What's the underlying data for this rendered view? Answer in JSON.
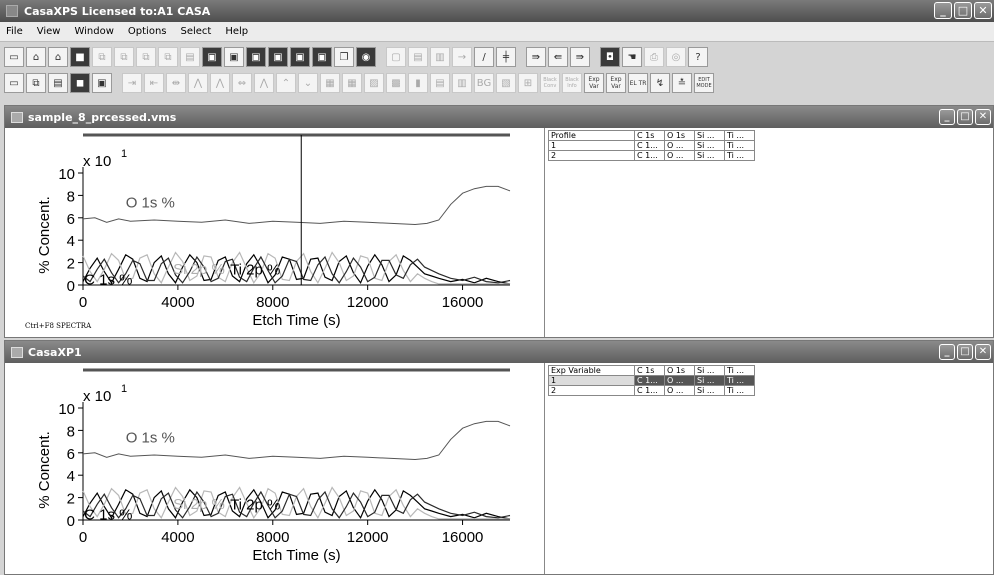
{
  "app": {
    "title": "CasaXPS Licensed to:A1 CASA",
    "window_buttons": [
      "_",
      "□",
      "✕"
    ]
  },
  "menu": [
    "File",
    "View",
    "Window",
    "Options",
    "Select",
    "Help"
  ],
  "toolbar1": [
    "new-icon",
    "open-icon",
    "open-multi-icon",
    "save-icon",
    "copy-icon",
    "copy2-icon",
    "copy3-icon",
    "copy4-icon",
    "paste-icon",
    "disk1-icon",
    "disk2-icon",
    "disk3-icon",
    "disk4-icon",
    "disk5-icon",
    "disk6-icon",
    "pages-icon",
    "camera-icon",
    "frame-icon",
    "frame2-icon",
    "frame3-icon",
    "arrow-icon",
    "line-icon",
    "chart-icon",
    "print-icon",
    "print2-icon",
    "print3-icon",
    "bucket-icon",
    "hand-icon",
    "printer-icon",
    "preview-icon",
    "help-icon"
  ],
  "toolbar2": [
    "tile-icon",
    "tile2-icon",
    "tile3-icon",
    "tile4-icon",
    "tile5-icon",
    "step-icon",
    "shrink-icon",
    "expand-icon",
    "peak1-icon",
    "peak2-icon",
    "peak3-icon",
    "peak4-icon",
    "peak5-icon",
    "peak6-icon",
    "grid1-icon",
    "grid2-icon",
    "grid3-icon",
    "grid4-icon",
    "bar1-icon",
    "bar2-icon",
    "bar3-icon",
    "bg-icon",
    "sub-icon",
    "fit-icon",
    "black-icon",
    "black2-icon",
    "expvar-icon",
    "expvar2-icon",
    "el-icon",
    "shift-icon",
    "stack-icon",
    "edit-icon"
  ],
  "toolbar2_labels": {
    "bg": "BG",
    "black": "Black Conv",
    "black2": "Black Info",
    "expvar": "Exp Var",
    "expvar2": "Exp Var",
    "el": "EL TR",
    "edit": "EDIT MODE"
  },
  "window1": {
    "title": "sample_8_prcessed.vms",
    "table": {
      "columns": [
        "Profile",
        "C 1s",
        "O 1s",
        "Si ...",
        "Ti ..."
      ],
      "rows": [
        [
          "1",
          "C 1...",
          "O ...",
          "Si ...",
          "Ti ..."
        ],
        [
          "2",
          "C 1...",
          "O ...",
          "Si ...",
          "Ti ..."
        ]
      ]
    },
    "footer_label": "Ctrl+F8 SPECTRA",
    "cursor_x": 9200
  },
  "window2": {
    "title": "CasaXP1",
    "table": {
      "columns": [
        "Exp Variable",
        "C 1s",
        "O 1s",
        "Si ...",
        "Ti ..."
      ],
      "rows": [
        [
          "1",
          "C 1...",
          "O ...",
          "Si ...",
          "Ti ..."
        ],
        [
          "2",
          "C 1...",
          "O ...",
          "Si ...",
          "Ti ..."
        ]
      ],
      "selected_row": 0
    }
  },
  "chart_data": [
    {
      "type": "line",
      "xlabel": "Etch Time (s)",
      "ylabel": "% Concent.",
      "y_multiplier": "x 10",
      "y_multiplier_exp": "1",
      "xlim": [
        0,
        18000
      ],
      "ylim": [
        0,
        10
      ],
      "xticks": [
        0,
        4000,
        8000,
        12000,
        16000
      ],
      "yticks": [
        0,
        2,
        4,
        6,
        8,
        10
      ],
      "series_labels": [
        "O 1s %",
        "C 1s %",
        "Si 2p %",
        "Ti 2p %"
      ],
      "series": [
        {
          "name": "O 1s %",
          "color": "#555555",
          "x": [
            0,
            500,
            1000,
            1500,
            2000,
            3000,
            4000,
            5000,
            6000,
            7000,
            8000,
            9000,
            10000,
            11000,
            12000,
            13000,
            14000,
            14500,
            15000,
            15500,
            16000,
            16500,
            17000,
            17500,
            18000
          ],
          "values": [
            5.9,
            6.0,
            5.6,
            5.9,
            5.7,
            5.8,
            5.7,
            5.6,
            5.8,
            5.5,
            5.7,
            5.6,
            5.5,
            5.7,
            5.6,
            5.5,
            5.4,
            5.5,
            5.8,
            7.2,
            8.2,
            8.6,
            8.8,
            8.8,
            8.4
          ]
        },
        {
          "name": "C 1s %",
          "color": "#000000",
          "x": [
            0,
            300,
            600,
            900,
            1200,
            1500,
            1800,
            2100,
            2400,
            2700,
            3000,
            3300,
            3600,
            3900,
            4200,
            4500,
            4800,
            5100,
            5400,
            5700,
            6000,
            6300,
            6600,
            6900,
            7200,
            7500,
            7800,
            8100,
            8400,
            8700,
            9000,
            9300,
            9600,
            9900,
            10200,
            10500,
            10800,
            11100,
            11400,
            11700,
            12000,
            12300,
            12600,
            12900,
            13200,
            13500,
            13800,
            14100,
            14400,
            14700,
            15000,
            15500,
            16000,
            16500,
            17000,
            17500,
            18000
          ],
          "values": [
            0.3,
            1.5,
            2.4,
            1.2,
            0.2,
            1.4,
            2.7,
            2.3,
            0.6,
            0.3,
            2.0,
            2.6,
            1.0,
            0.2,
            1.6,
            2.7,
            2.0,
            0.4,
            0.5,
            2.2,
            2.5,
            0.8,
            0.3,
            1.9,
            2.7,
            1.6,
            0.2,
            0.9,
            2.5,
            2.3,
            0.5,
            0.6,
            2.3,
            2.4,
            0.7,
            0.4,
            2.1,
            2.6,
            1.1,
            0.2,
            1.7,
            2.7,
            1.8,
            0.3,
            0.9,
            2.6,
            2.2,
            1.6,
            1.0,
            0.8,
            0.6,
            0.3,
            0.5,
            0.2,
            0.6,
            0.3,
            0.1
          ]
        },
        {
          "name": "Si 2p %",
          "color": "#b8b8b8",
          "x": [
            0,
            300,
            600,
            900,
            1200,
            1500,
            1800,
            2100,
            2400,
            2700,
            3000,
            3300,
            3600,
            3900,
            4200,
            4500,
            4800,
            5100,
            5400,
            5700,
            6000,
            6300,
            6600,
            6900,
            7200,
            7500,
            7800,
            8100,
            8400,
            8700,
            9000,
            9300,
            9600,
            9900,
            10200,
            10500,
            10800,
            11100,
            11400,
            11700,
            12000,
            12300,
            12600,
            12900,
            13200,
            13500,
            13800,
            14100,
            14400,
            14700,
            15000,
            16000,
            17000,
            18000
          ],
          "values": [
            2.6,
            1.2,
            0.3,
            1.4,
            2.8,
            2.2,
            0.5,
            0.6,
            2.4,
            2.7,
            1.0,
            0.2,
            1.6,
            2.9,
            2.1,
            0.4,
            0.8,
            2.6,
            2.5,
            0.7,
            0.3,
            2.0,
            2.9,
            1.5,
            0.2,
            1.1,
            2.8,
            2.4,
            0.5,
            0.4,
            2.1,
            2.8,
            1.2,
            0.2,
            1.5,
            2.9,
            2.0,
            0.4,
            0.8,
            2.6,
            2.4,
            0.6,
            0.4,
            2.1,
            2.7,
            1.3,
            0.3,
            1.0,
            0.6,
            0.3,
            0.1,
            0.1,
            0.1,
            0.1
          ]
        },
        {
          "name": "Ti 2p %",
          "color": "#2a2a2a",
          "x": [
            0,
            300,
            600,
            900,
            1200,
            1500,
            1800,
            2100,
            2400,
            2700,
            3000,
            3300,
            3600,
            3900,
            4200,
            4500,
            4800,
            5100,
            5400,
            5700,
            6000,
            6300,
            6600,
            6900,
            7200,
            7500,
            7800,
            8100,
            8400,
            8700,
            9000,
            9300,
            9600,
            9900,
            10200,
            10500,
            10800,
            11100,
            11400,
            11700,
            12000,
            12300,
            12600,
            12900,
            13200,
            13500,
            13800,
            14100,
            14400,
            14700,
            15000,
            15500,
            16000,
            16500,
            17000,
            17500,
            18000
          ],
          "values": [
            0.8,
            0.3,
            1.4,
            2.3,
            1.1,
            0.2,
            1.0,
            2.2,
            1.9,
            0.4,
            0.4,
            1.9,
            2.4,
            0.9,
            0.2,
            1.2,
            2.5,
            1.6,
            0.3,
            0.6,
            2.1,
            2.3,
            0.7,
            0.3,
            1.5,
            2.5,
            1.3,
            0.2,
            0.8,
            2.3,
            2.1,
            0.5,
            0.4,
            1.8,
            2.5,
            1.0,
            0.2,
            1.2,
            2.4,
            1.6,
            0.3,
            0.7,
            2.2,
            2.2,
            0.9,
            0.6,
            1.8,
            2.3,
            1.6,
            1.3,
            1.0,
            0.6,
            0.4,
            0.7,
            0.3,
            0.2,
            0.4
          ]
        }
      ],
      "cursor": true,
      "grid": false
    },
    {
      "type": "line",
      "xlabel": "Etch Time (s)",
      "ylabel": "% Concent.",
      "y_multiplier": "x 10",
      "y_multiplier_exp": "1",
      "xlim": [
        0,
        18000
      ],
      "ylim": [
        0,
        10
      ],
      "xticks": [
        0,
        4000,
        8000,
        12000,
        16000
      ],
      "yticks": [
        0,
        2,
        4,
        6,
        8,
        10
      ],
      "series_labels": [
        "O 1s %",
        "C 1s %",
        "Si 2p %",
        "Ti 2p %"
      ],
      "cursor": false,
      "grid": false
    }
  ]
}
